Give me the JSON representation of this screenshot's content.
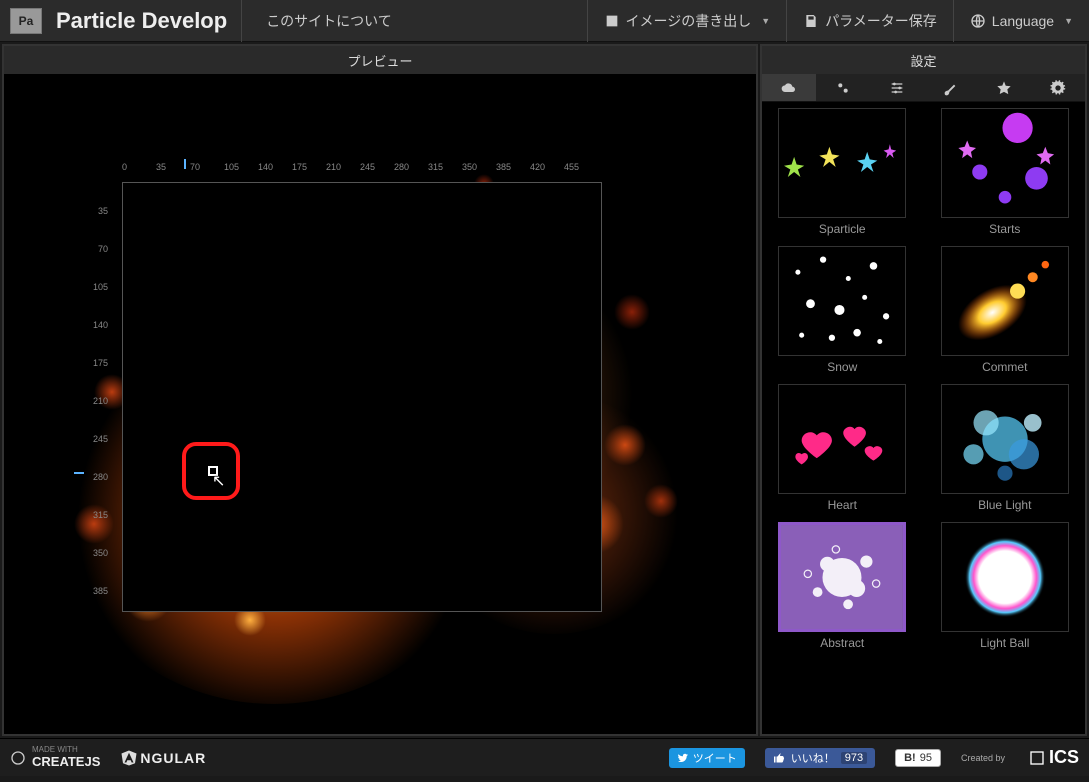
{
  "header": {
    "logo_text": "Pa",
    "title": "Particle Develop",
    "about": "このサイトについて",
    "export": "イメージの書き出し",
    "save": "パラメーター保存",
    "language": "Language"
  },
  "preview": {
    "title": "プレビュー",
    "h_ticks": [
      "0",
      "35",
      "70",
      "105",
      "140",
      "175",
      "210",
      "245",
      "280",
      "315",
      "350",
      "385",
      "420",
      "455"
    ],
    "v_ticks": [
      "35",
      "70",
      "105",
      "140",
      "175",
      "210",
      "245",
      "280",
      "315",
      "350",
      "385"
    ]
  },
  "settings": {
    "title": "設定",
    "tabs": [
      "cloud",
      "cogs",
      "sliders",
      "brush",
      "star",
      "gear"
    ],
    "active_tab": 0,
    "presets": [
      {
        "id": "sparticle",
        "label": "Sparticle",
        "active": false
      },
      {
        "id": "starts",
        "label": "Starts",
        "active": false
      },
      {
        "id": "snow",
        "label": "Snow",
        "active": false
      },
      {
        "id": "commet",
        "label": "Commet",
        "active": false
      },
      {
        "id": "heart",
        "label": "Heart",
        "active": false
      },
      {
        "id": "bluelight",
        "label": "Blue Light",
        "active": false
      },
      {
        "id": "abstract",
        "label": "Abstract",
        "active": true
      },
      {
        "id": "lightball",
        "label": "Light Ball",
        "active": false
      }
    ]
  },
  "footer": {
    "createjs": "CREATEJS",
    "madewith": "MADE WITH",
    "angular": "NGULAR",
    "tweet": "ツイート",
    "like": "いいね！",
    "like_count": "973",
    "hatena": "B!",
    "hatena_count": "95",
    "created_by": "Created by",
    "brand": "ICS"
  }
}
